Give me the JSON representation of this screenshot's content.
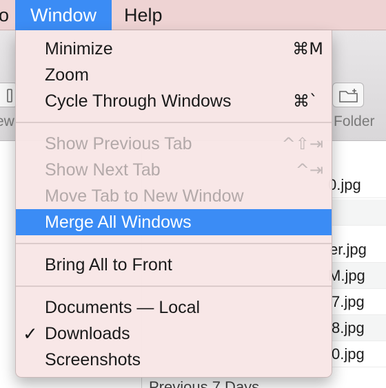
{
  "menubar": {
    "partial_prev": "o",
    "window": "Window",
    "help": "Help"
  },
  "finder": {
    "toolbar_left_label": "ew",
    "toolbar_right_label": "Folder",
    "files": [
      "0.jpg",
      "er.jpg",
      "M.jpg",
      "7.jpg",
      "8.jpg",
      "0.jpg"
    ],
    "section_label": "Previous 7 Days"
  },
  "window_menu": {
    "items": [
      {
        "label": "Minimize",
        "shortcut": "⌘M"
      },
      {
        "label": "Zoom",
        "shortcut": ""
      },
      {
        "label": "Cycle Through Windows",
        "shortcut": "⌘`"
      },
      {
        "label": "Show Previous Tab",
        "shortcut": "^⇧⇥",
        "disabled": true
      },
      {
        "label": "Show Next Tab",
        "shortcut": "^⇥",
        "disabled": true
      },
      {
        "label": "Move Tab to New Window",
        "shortcut": "",
        "disabled": true
      },
      {
        "label": "Merge All Windows",
        "shortcut": "",
        "highlighted": true
      },
      {
        "label": "Bring All to Front",
        "shortcut": ""
      },
      {
        "label": "Documents — Local",
        "shortcut": ""
      },
      {
        "label": "Downloads",
        "shortcut": "",
        "checked": true,
        "check_mark": "✓"
      },
      {
        "label": "Screenshots",
        "shortcut": ""
      }
    ]
  },
  "colors": {
    "highlight": "#3b8cf5",
    "menu_bg": "#f8e6e6",
    "disabled_text": "#b3a9a9"
  }
}
